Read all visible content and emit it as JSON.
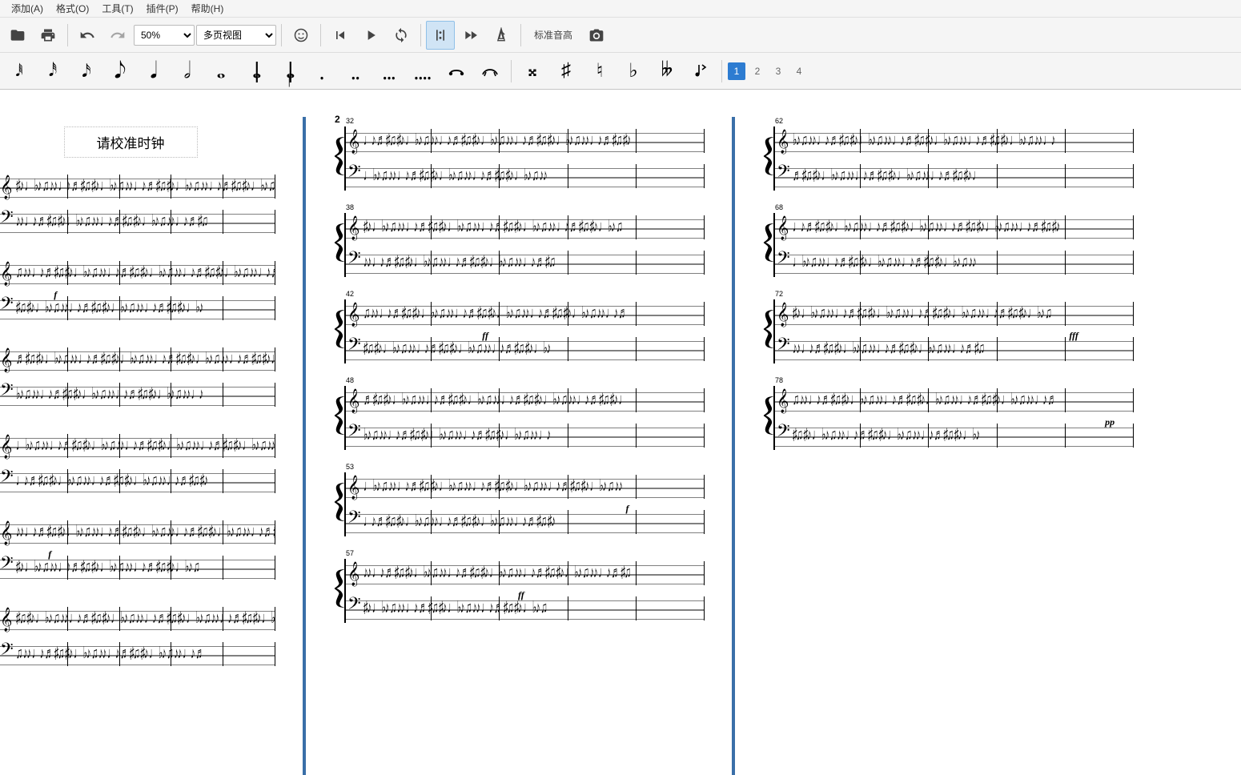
{
  "menubar": {
    "items": [
      "添加(A)",
      "格式(O)",
      "工具(T)",
      "插件(P)",
      "帮助(H)"
    ]
  },
  "toolbar1": {
    "zoom_value": "50%",
    "view_value": "多页视图",
    "playback_label": "标准音高"
  },
  "toolbar2": {
    "voice_buttons": [
      "1",
      "2",
      "3",
      "4"
    ],
    "active_voice": "1"
  },
  "score": {
    "title": "请校准时钟",
    "pages": [
      {
        "page_number": "",
        "systems": [
          {
            "measure_start": "",
            "dynamic": "",
            "dyn_pos": ""
          },
          {
            "measure_start": "",
            "dynamic": "f",
            "dyn_pos": "20"
          },
          {
            "measure_start": "",
            "dynamic": "",
            "dyn_pos": ""
          },
          {
            "measure_start": "",
            "dynamic": "",
            "dyn_pos": ""
          },
          {
            "measure_start": "",
            "dynamic": "f",
            "dyn_pos": "18"
          },
          {
            "measure_start": "",
            "dynamic": "",
            "dyn_pos": ""
          }
        ]
      },
      {
        "page_number": "2",
        "systems": [
          {
            "measure_start": "32",
            "dynamic": "",
            "dyn_pos": ""
          },
          {
            "measure_start": "38",
            "dynamic": "",
            "dyn_pos": ""
          },
          {
            "measure_start": "42",
            "dynamic": "ff",
            "dyn_pos": "38"
          },
          {
            "measure_start": "48",
            "dynamic": "",
            "dyn_pos": ""
          },
          {
            "measure_start": "53",
            "dynamic": "f",
            "dyn_pos": "78"
          },
          {
            "measure_start": "57",
            "dynamic": "ff",
            "dyn_pos": "48"
          }
        ]
      },
      {
        "page_number": "",
        "systems": [
          {
            "measure_start": "62",
            "dynamic": "",
            "dyn_pos": ""
          },
          {
            "measure_start": "68",
            "dynamic": "",
            "dyn_pos": ""
          },
          {
            "measure_start": "72",
            "dynamic": "fff",
            "dyn_pos": "82"
          },
          {
            "measure_start": "78",
            "dynamic": "pp",
            "dyn_pos": "92"
          }
        ]
      }
    ]
  }
}
